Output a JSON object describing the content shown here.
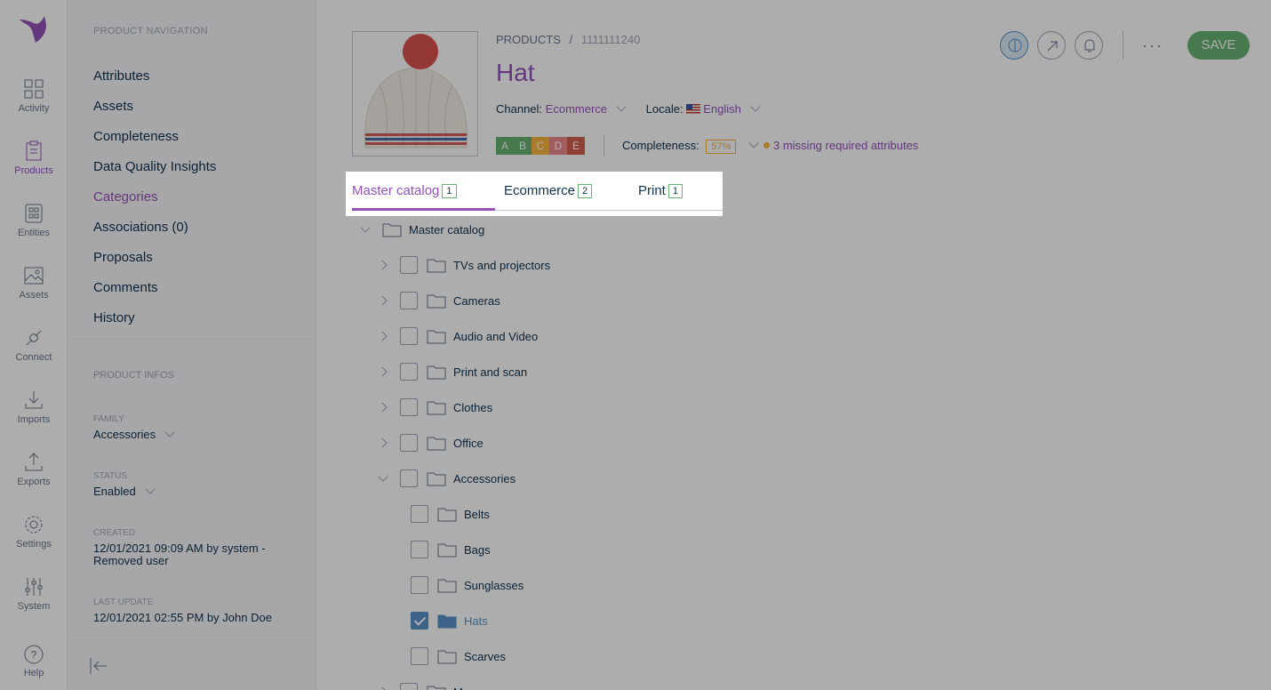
{
  "menu": {
    "items": [
      {
        "label": "Activity",
        "icon": "activity-icon"
      },
      {
        "label": "Products",
        "icon": "products-icon",
        "active": true
      },
      {
        "label": "Entities",
        "icon": "entities-icon"
      },
      {
        "label": "Assets",
        "icon": "assets-icon"
      },
      {
        "label": "Connect",
        "icon": "connect-icon"
      },
      {
        "label": "Imports",
        "icon": "imports-icon"
      },
      {
        "label": "Exports",
        "icon": "exports-icon"
      },
      {
        "label": "Settings",
        "icon": "settings-icon"
      },
      {
        "label": "System",
        "icon": "system-icon"
      }
    ],
    "help": "Help"
  },
  "product_nav": {
    "title": "PRODUCT NAVIGATION",
    "items": [
      "Attributes",
      "Assets",
      "Completeness",
      "Data Quality Insights",
      "Categories",
      "Associations (0)",
      "Proposals",
      "Comments",
      "History"
    ],
    "active_item": "Categories",
    "infos_title": "PRODUCT INFOS",
    "family_label": "FAMILY",
    "family_value": "Accessories",
    "status_label": "STATUS",
    "status_value": "Enabled",
    "created_label": "CREATED",
    "created_value": "12/01/2021 09:09 AM by system - Removed user",
    "updated_label": "LAST UPDATE",
    "updated_value": "12/01/2021 02:55 PM by John Doe"
  },
  "header": {
    "breadcrumb_root": "PRODUCTS",
    "breadcrumb_sep": "/",
    "sku": "1111111240",
    "title": "Hat",
    "channel_label": "Channel:",
    "channel_value": "Ecommerce",
    "locale_label": "Locale:",
    "locale_value": "English",
    "grades": [
      "A",
      "B",
      "C",
      "D",
      "E"
    ],
    "grade_colors": [
      "#67b373",
      "#67b373",
      "#f9b53f",
      "#ef8b8b",
      "#d4604f"
    ],
    "completeness_label": "Completeness:",
    "completeness_value": "57%",
    "missing_text": "3 missing required attributes",
    "save_label": "SAVE",
    "more_label": "···"
  },
  "tabs": [
    {
      "label": "Master catalog",
      "count": "1"
    },
    {
      "label": "Ecommerce",
      "count": "2"
    },
    {
      "label": "Print",
      "count": "1"
    }
  ],
  "tree": [
    {
      "label": "Master catalog",
      "level": 0,
      "toggle": "down",
      "checkbox": false
    },
    {
      "label": "TVs and projectors",
      "level": 1,
      "toggle": "right",
      "checkbox": true,
      "checked": false
    },
    {
      "label": "Cameras",
      "level": 1,
      "toggle": "right",
      "checkbox": true,
      "checked": false
    },
    {
      "label": "Audio and Video",
      "level": 1,
      "toggle": "right",
      "checkbox": true,
      "checked": false
    },
    {
      "label": "Print and scan",
      "level": 1,
      "toggle": "right",
      "checkbox": true,
      "checked": false
    },
    {
      "label": "Clothes",
      "level": 1,
      "toggle": "right",
      "checkbox": true,
      "checked": false
    },
    {
      "label": "Office",
      "level": 1,
      "toggle": "right",
      "checkbox": true,
      "checked": false
    },
    {
      "label": "Accessories",
      "level": 1,
      "toggle": "down",
      "checkbox": true,
      "checked": false
    },
    {
      "label": "Belts",
      "level": 2,
      "toggle": "none",
      "checkbox": true,
      "checked": false
    },
    {
      "label": "Bags",
      "level": 2,
      "toggle": "none",
      "checkbox": true,
      "checked": false
    },
    {
      "label": "Sunglasses",
      "level": 2,
      "toggle": "none",
      "checkbox": true,
      "checked": false
    },
    {
      "label": "Hats",
      "level": 2,
      "toggle": "none",
      "checkbox": true,
      "checked": true
    },
    {
      "label": "Scarves",
      "level": 2,
      "toggle": "none",
      "checkbox": true,
      "checked": false
    },
    {
      "label": "Men",
      "level": 1,
      "toggle": "right",
      "checkbox": true,
      "checked": false
    }
  ]
}
